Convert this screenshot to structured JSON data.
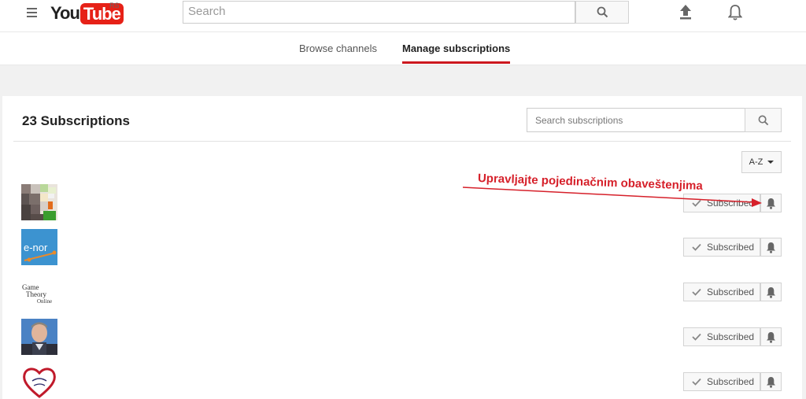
{
  "masthead": {
    "logo_you": "You",
    "logo_tube": "Tube",
    "country": "RS",
    "search_placeholder": "Search"
  },
  "tabs": [
    {
      "label": "Browse channels",
      "active": false
    },
    {
      "label": "Manage subscriptions",
      "active": true
    }
  ],
  "subscriptions": {
    "title": "23 Subscriptions",
    "search_placeholder": "Search subscriptions",
    "sort_label": "A-Z",
    "subscribed_label": "Subscribed",
    "rows": [
      {
        "avatar": "pixel-art-avatar"
      },
      {
        "avatar": "e-nor-logo-avatar",
        "avatar_text": "e-nor"
      },
      {
        "avatar": "game-theory-online-avatar",
        "avatar_lines": [
          "Game",
          "Theory",
          "Online"
        ]
      },
      {
        "avatar": "man-photo-avatar"
      },
      {
        "avatar": "heart-logo-avatar"
      }
    ]
  },
  "annotation": {
    "text": "Upravljajte pojedinačnim obaveštenjima",
    "color": "#d6202a"
  },
  "colors": {
    "brand_red": "#e62117",
    "tab_underline": "#cc181e"
  }
}
